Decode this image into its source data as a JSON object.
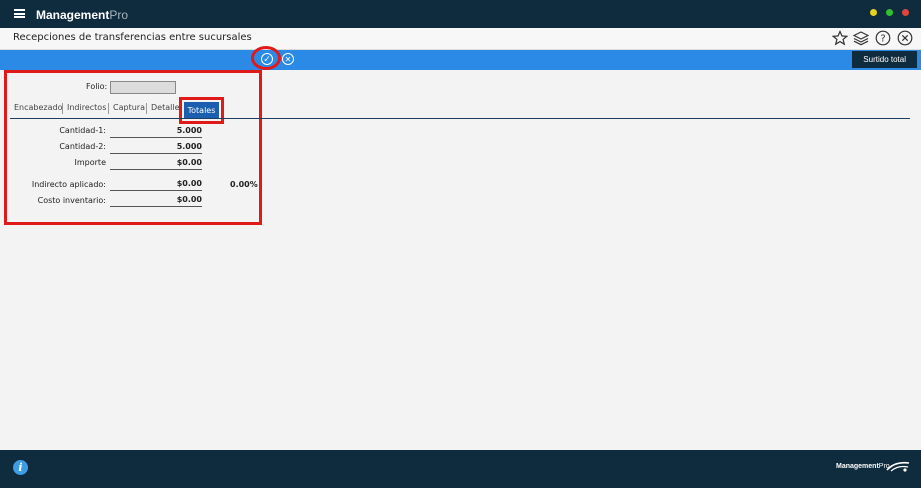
{
  "app": {
    "brand_bold": "Management",
    "brand_light": "Pro"
  },
  "window_controls": [
    {
      "color": "#e6d11b"
    },
    {
      "color": "#2ec22e"
    },
    {
      "color": "#e0463a"
    }
  ],
  "page": {
    "title": "Recepciones de transferencias entre sucursales"
  },
  "title_icons": [
    "star-icon",
    "layers-icon",
    "help-icon",
    "close-icon"
  ],
  "actions": {
    "confirm_icon": "✓",
    "cancel_icon": "✕",
    "surtido_label": "Surtido total"
  },
  "form": {
    "folio_label": "Folio:",
    "folio_value": ""
  },
  "tabs": [
    {
      "label": "Encabezado"
    },
    {
      "label": "Indirectos"
    },
    {
      "label": "Captura"
    },
    {
      "label": "Detalle"
    },
    {
      "label": "Totales",
      "active": true
    }
  ],
  "totals": {
    "cantidad1": {
      "label": "Cantidad-1:",
      "value": "5.000"
    },
    "cantidad2": {
      "label": "Cantidad-2:",
      "value": "5.000"
    },
    "importe": {
      "label": "Importe",
      "value": "$0.00"
    },
    "indirecto": {
      "label": "Indirecto aplicado:",
      "value": "$0.00",
      "percent": "0.00%"
    },
    "costo": {
      "label": "Costo inventario:",
      "value": "$0.00"
    }
  },
  "footer": {
    "info_icon": "i",
    "brand_bold": "Management",
    "brand_light": "Pro"
  },
  "colors": {
    "dark": "#0f2b3e",
    "accent": "#2b8ae6",
    "highlight": "#e01919",
    "tab_active": "#1c5fae"
  }
}
